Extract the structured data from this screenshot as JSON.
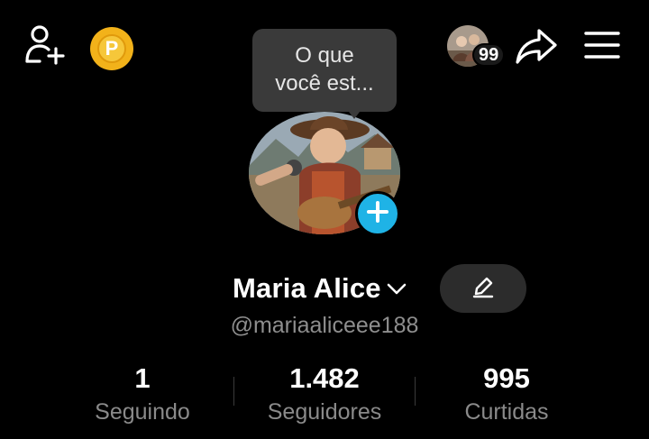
{
  "header": {
    "coin_letter": "P",
    "friends_count": "99",
    "icons": {
      "add_friend": "person-add-icon",
      "coin": "coin-icon",
      "share": "share-icon",
      "menu": "hamburger-menu-icon"
    }
  },
  "note": {
    "text_line1": "O que",
    "text_line2": "você est..."
  },
  "profile": {
    "name": "Maria Alice",
    "username": "@mariaaliceee188"
  },
  "stats": [
    {
      "value": "1",
      "label": "Seguindo"
    },
    {
      "value": "1.482",
      "label": "Seguidores"
    },
    {
      "value": "995",
      "label": "Curtidas"
    }
  ],
  "colors": {
    "background": "#000000",
    "accent_blue": "#1fb3e6",
    "coin_gold": "#f2b21a",
    "muted_text": "#8a8a8a"
  }
}
